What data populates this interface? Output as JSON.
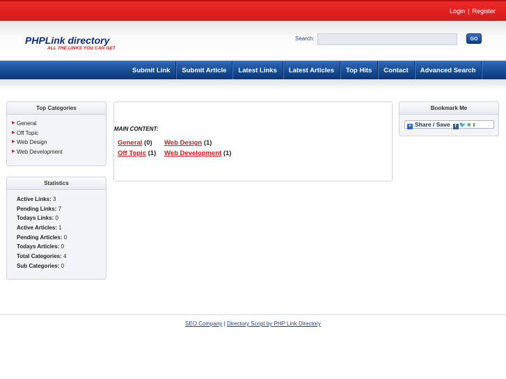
{
  "topbar": {
    "login": "Login",
    "separator": "|",
    "register": "Register"
  },
  "header": {
    "logo": "PHPLink directory",
    "tagline": "ALL THE LINKS YOU CAN GET",
    "search_label": "Search:",
    "search_value": "",
    "go_label": "GO"
  },
  "nav": {
    "items": [
      "Submit Link",
      "Submit Article",
      "Latest Links",
      "Latest Articles",
      "Top Hits",
      "Contact",
      "Advanced Search"
    ]
  },
  "top_categories": {
    "title": "Top Categories",
    "items": [
      "General",
      "Off Topic",
      "Web Design",
      "Web Development"
    ]
  },
  "statistics": {
    "title": "Statistics",
    "rows": [
      {
        "label": "Active Links:",
        "value": "3"
      },
      {
        "label": "Pending Links:",
        "value": "7"
      },
      {
        "label": "Todays Links:",
        "value": "0"
      },
      {
        "label": "Active Articles:",
        "value": "1"
      },
      {
        "label": "Pending Articles:",
        "value": "0"
      },
      {
        "label": "Todays Articles:",
        "value": "0"
      },
      {
        "label": "Total Categories:",
        "value": "4"
      },
      {
        "label": "Sub Categories:",
        "value": "0"
      }
    ]
  },
  "main": {
    "heading": "MAIN CONTENT:",
    "categories": [
      {
        "name": "General",
        "count": "(0)"
      },
      {
        "name": "Web Design",
        "count": "(1)"
      },
      {
        "name": "Off Topic",
        "count": "(1)"
      },
      {
        "name": "Web Development",
        "count": "(1)"
      }
    ]
  },
  "bookmark": {
    "title": "Bookmark Me",
    "share_label": "Share / Save"
  },
  "footer": {
    "seo_link": "SEO Company",
    "separator": "|",
    "script_link": "Directory Script by PHP Link Directory"
  }
}
